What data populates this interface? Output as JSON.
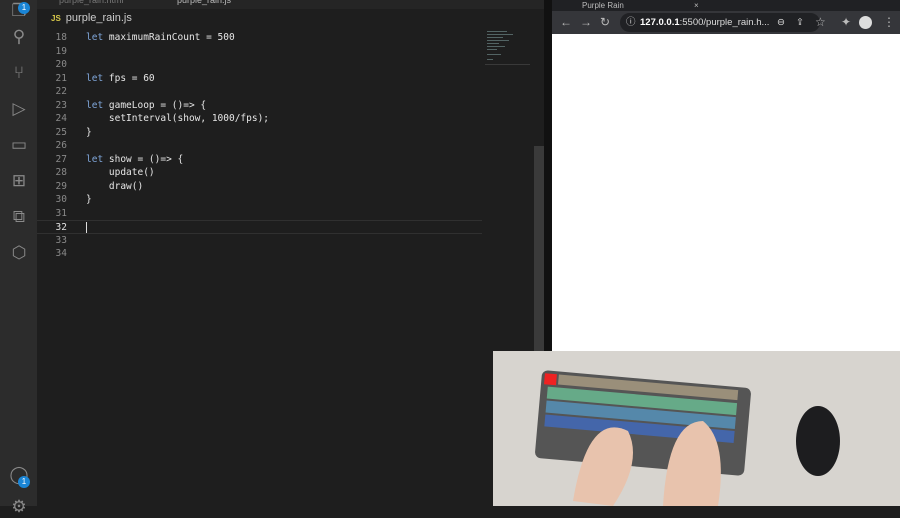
{
  "activity": {
    "explorer_badge": "1",
    "account_badge": "1"
  },
  "editor": {
    "tabs": [
      "purple_rain.html",
      "purple_rain.js"
    ],
    "file_name": "purple_rain.js",
    "file_icon": "JS",
    "lines": [
      {
        "n": "18",
        "kw": "let",
        "rest": " maximumRainCount = 500"
      },
      {
        "n": "19",
        "kw": "",
        "rest": ""
      },
      {
        "n": "20",
        "kw": "",
        "rest": ""
      },
      {
        "n": "21",
        "kw": "let",
        "rest": " fps = 60"
      },
      {
        "n": "22",
        "kw": "",
        "rest": ""
      },
      {
        "n": "23",
        "kw": "let",
        "rest": " gameLoop = ()=> {"
      },
      {
        "n": "24",
        "kw": "",
        "rest": "    setInterval(show, 1000/fps);"
      },
      {
        "n": "25",
        "kw": "",
        "rest": "}"
      },
      {
        "n": "26",
        "kw": "",
        "rest": ""
      },
      {
        "n": "27",
        "kw": "let",
        "rest": " show = ()=> {"
      },
      {
        "n": "28",
        "kw": "",
        "rest": "    update()"
      },
      {
        "n": "29",
        "kw": "",
        "rest": "    draw()"
      },
      {
        "n": "30",
        "kw": "",
        "rest": "}"
      },
      {
        "n": "31",
        "kw": "",
        "rest": ""
      },
      {
        "n": "32",
        "kw": "",
        "rest": ""
      },
      {
        "n": "33",
        "kw": "",
        "rest": ""
      },
      {
        "n": "34",
        "kw": "",
        "rest": ""
      }
    ]
  },
  "browser": {
    "tab_title": "Purple Rain",
    "url_host": "127.0.0.1",
    "url_rest": ":5500/purple_rain.h..."
  }
}
